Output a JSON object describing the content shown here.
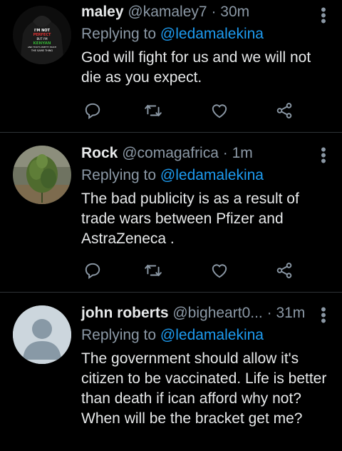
{
  "tweets": [
    {
      "name": "maley",
      "handle": "@kamaley7",
      "dot": "·",
      "time": "30m",
      "reply_prefix": "Replying to",
      "reply_to": "@ledamalekina",
      "text": "God will fight for us and we will not die as you expect.",
      "avatar": {
        "type": "hoodie",
        "lines": [
          "I'M NOT",
          "PERFECT",
          "BUT I'M",
          "KENYAN",
          "AND THAT'S PRETTY MUCH",
          "THE SAME THING"
        ]
      }
    },
    {
      "name": "Rock",
      "handle": "@comagafrica",
      "dot": "·",
      "time": "1m",
      "reply_prefix": "Replying to",
      "reply_to": "@ledamalekina",
      "text": "The bad publicity is as a result of trade wars between Pfizer and AstraZeneca .",
      "avatar": {
        "type": "plant"
      }
    },
    {
      "name": "john roberts",
      "handle": "@bigheart0...",
      "dot": "·",
      "time": "31m",
      "reply_prefix": "Replying to",
      "reply_to": "@ledamalekina",
      "text": "The government should allow it's citizen to be vaccinated. Life is better than death if ican afford why not? When will be the bracket  get me?",
      "avatar": {
        "type": "default"
      }
    }
  ],
  "icons": [
    "reply-icon",
    "retweet-icon",
    "like-icon",
    "share-icon",
    "more-icon"
  ],
  "colors": {
    "background": "#000000",
    "link": "#1d9bf0",
    "muted": "#8b98a5",
    "text": "#e7e9ea"
  }
}
